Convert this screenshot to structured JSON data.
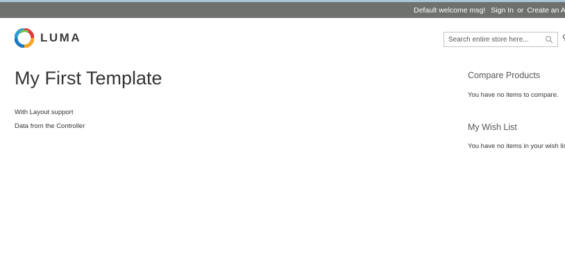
{
  "header_panel": {
    "welcome": "Default welcome msg!",
    "sign_in": "Sign In",
    "or": "or",
    "create_account": "Create an Accou"
  },
  "logo": {
    "text": "LUMA"
  },
  "search": {
    "placeholder": "Search entire store here..."
  },
  "main": {
    "title": "My First Template",
    "lines": [
      "With Layout support",
      "Data from the Controller"
    ]
  },
  "sidebar": {
    "compare": {
      "title": "Compare Products",
      "text": "You have no items to compare."
    },
    "wishlist": {
      "title": "My Wish List",
      "text": "You have no items in your wish lis"
    }
  },
  "colors": {
    "panel_bg": "#6e716e",
    "panel_top_border": "#a8c7d8"
  }
}
